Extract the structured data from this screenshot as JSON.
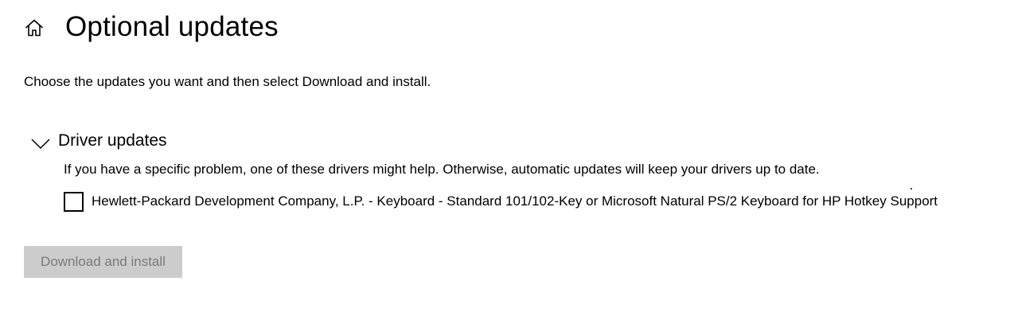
{
  "header": {
    "title": "Optional updates",
    "home_icon": "home-icon"
  },
  "intro": {
    "text": "Choose the updates you want and then select Download and install."
  },
  "driver_section": {
    "title": "Driver updates",
    "expanded": true,
    "chevron_icon": "chevron-down-icon",
    "description": "If you have a specific problem, one of these drivers might help. Otherwise, automatic updates will keep your drivers up to date.",
    "items": [
      {
        "label": "Hewlett-Packard Development Company, L.P. - Keyboard - Standard 101/102-Key or Microsoft Natural PS/2 Keyboard for HP Hotkey Support",
        "checked": false
      }
    ]
  },
  "actions": {
    "download_label": "Download and install",
    "download_enabled": false
  },
  "colors": {
    "background": "#ffffff",
    "text": "#000000",
    "button_disabled_bg": "#cccccc",
    "button_disabled_text": "#7a7a7a"
  }
}
